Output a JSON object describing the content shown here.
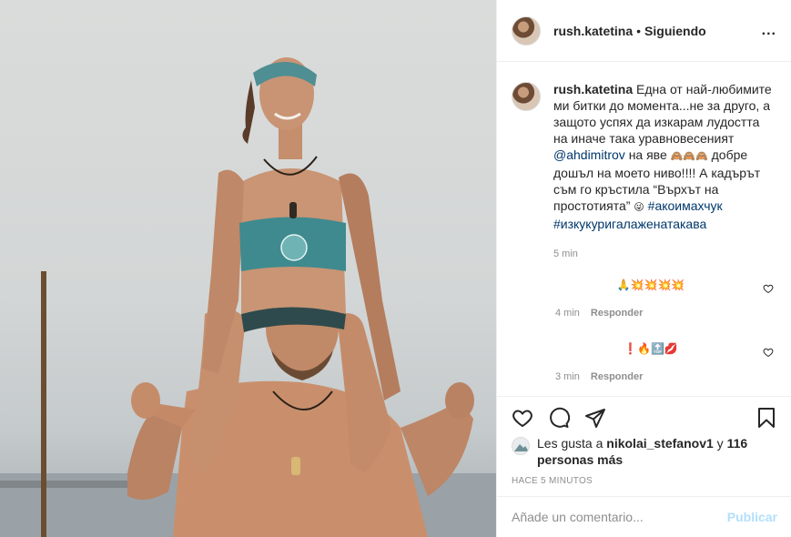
{
  "post": {
    "username": "rush.katetina",
    "separator": "•",
    "follow_status": "Siguiendo",
    "more_label": "...",
    "photo_alt": "Imagen"
  },
  "caption": {
    "username": "rush.katetina",
    "text_1": "Една от най-любимите ми битки до момента...не за друго, а защото успях да изкарам лудостта на иначе така уравновесеният",
    "mention": "@ahdimitrov",
    "text_2": "на яве",
    "emoji_1": "🙈🙈🙈",
    "text_3": "добре дошъл на моето ниво!!!! А кадърът съм го кръстила “Върхът на простотията”",
    "emoji_2": "😜",
    "hashtag_1": "#акоимахчук",
    "hashtag_2": "#изкукуригалаженатакава",
    "time": "5 min"
  },
  "comments": [
    {
      "emojis": "🙏💥💥💥💥",
      "time": "4 min",
      "reply_label": "Responder"
    },
    {
      "emojis": "❗🔥🔝💋",
      "time": "3 min",
      "reply_label": "Responder"
    }
  ],
  "likes": {
    "prefix": "Les gusta a",
    "user": "nikolai_stefanov1",
    "connector": "y",
    "others": "116 personas más"
  },
  "timestamp": "HACE 5 MINUTOS",
  "comment_box": {
    "placeholder": "Añade un comentario...",
    "post_label": "Publicar"
  },
  "icons": [
    "heart-icon",
    "comment-icon",
    "share-icon",
    "bookmark-icon",
    "more-icon"
  ]
}
